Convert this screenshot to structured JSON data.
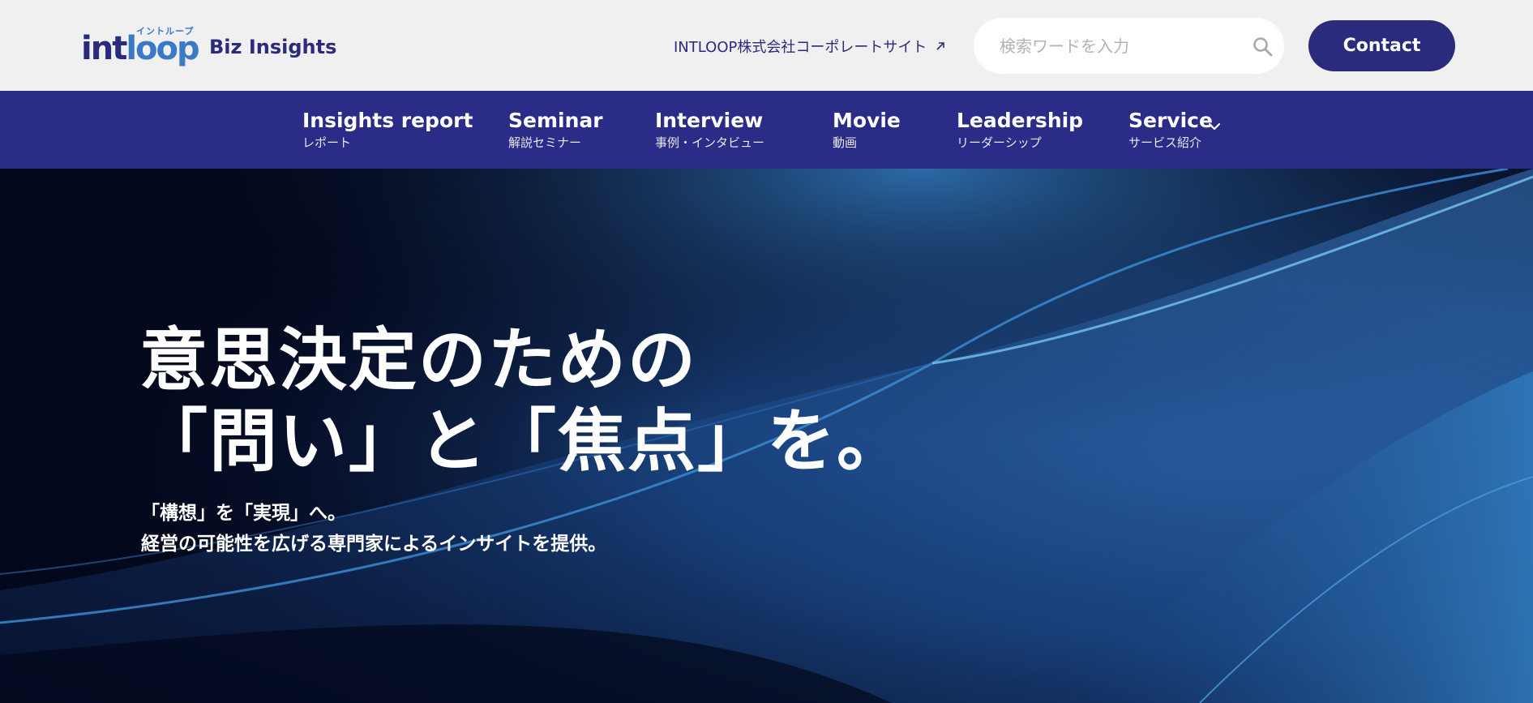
{
  "header": {
    "logo_kana": "イントループ",
    "logo_word_a": "int",
    "logo_word_b": "loop",
    "site_title": "Biz Insights",
    "corp_link_label": "INTLOOP株式会社コーポレートサイト",
    "search": {
      "placeholder": "検索ワードを入力",
      "value": ""
    },
    "contact_label": "Contact"
  },
  "nav": {
    "items": [
      {
        "en": "Insights report",
        "jp": "レポート"
      },
      {
        "en": "Seminar",
        "jp": "解説セミナー"
      },
      {
        "en": "Interview",
        "jp": "事例・インタビュー"
      },
      {
        "en": "Movie",
        "jp": "動画"
      },
      {
        "en": "Leadership",
        "jp": "リーダーシップ"
      },
      {
        "en": "Service",
        "jp": "サービス紹介"
      }
    ]
  },
  "hero": {
    "title_line1": "意思決定のための",
    "title_line2": "「問い」と「焦点」を。",
    "sub_line1": "「構想」を「実現」へ。",
    "sub_line2": "経営の可能性を広げる専門家によるインサイトを提供。"
  },
  "colors": {
    "brand_navy": "#2b2b7e",
    "nav_bg": "#2b2b88",
    "logo_blue": "#3a78c8",
    "header_bg": "#f0f0f1"
  },
  "icons": {
    "external": "external-link-icon",
    "search": "search-icon",
    "dropdown": "chevron-down-icon"
  }
}
